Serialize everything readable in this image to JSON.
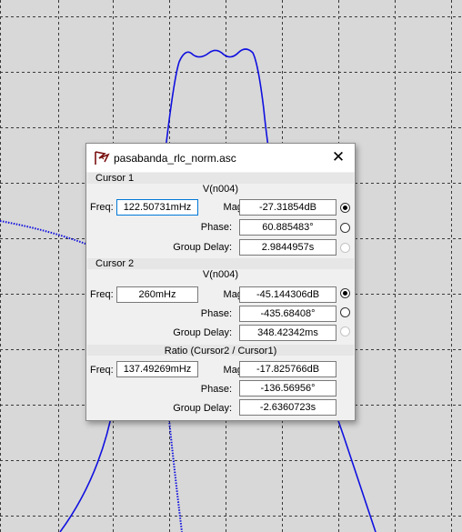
{
  "window": {
    "title": "pasabanda_rlc_norm.asc"
  },
  "cursor1": {
    "label": "Cursor 1",
    "trace": "V(n004)",
    "freq_label": "Freq:",
    "freq": "122.50731mHz",
    "mag_label": "Mag:",
    "mag": "-27.31854dB",
    "phase_label": "Phase:",
    "phase": "60.885483°",
    "gd_label": "Group Delay:",
    "gd": "2.9844957s"
  },
  "cursor2": {
    "label": "Cursor 2",
    "trace": "V(n004)",
    "freq_label": "Freq:",
    "freq": "260mHz",
    "mag_label": "Mag:",
    "mag": "-45.144306dB",
    "phase_label": "Phase:",
    "phase": "-435.68408°",
    "gd_label": "Group Delay:",
    "gd": "348.42342ms"
  },
  "ratio": {
    "label": "Ratio (Cursor2 / Cursor1)",
    "freq_label": "Freq:",
    "freq": "137.49269mHz",
    "mag_label": "Mag:",
    "mag": "-17.825766dB",
    "phase_label": "Phase:",
    "phase": "-136.56956°",
    "gd_label": "Group Delay:",
    "gd": "-2.6360723s"
  },
  "radios": {
    "cursor1_mag": "selected",
    "cursor1_phase": "unselected",
    "cursor1_gd": "disabled",
    "cursor2_mag": "selected",
    "cursor2_phase": "unselected",
    "cursor2_gd": "disabled"
  },
  "colors": {
    "trace": "#1010e0",
    "grid": "#3a3a3a",
    "plot_bg": "#d8d8d8",
    "focus": "#0078d7"
  },
  "icons": {
    "app": "ltspice-probe-icon",
    "close": "close-icon"
  }
}
